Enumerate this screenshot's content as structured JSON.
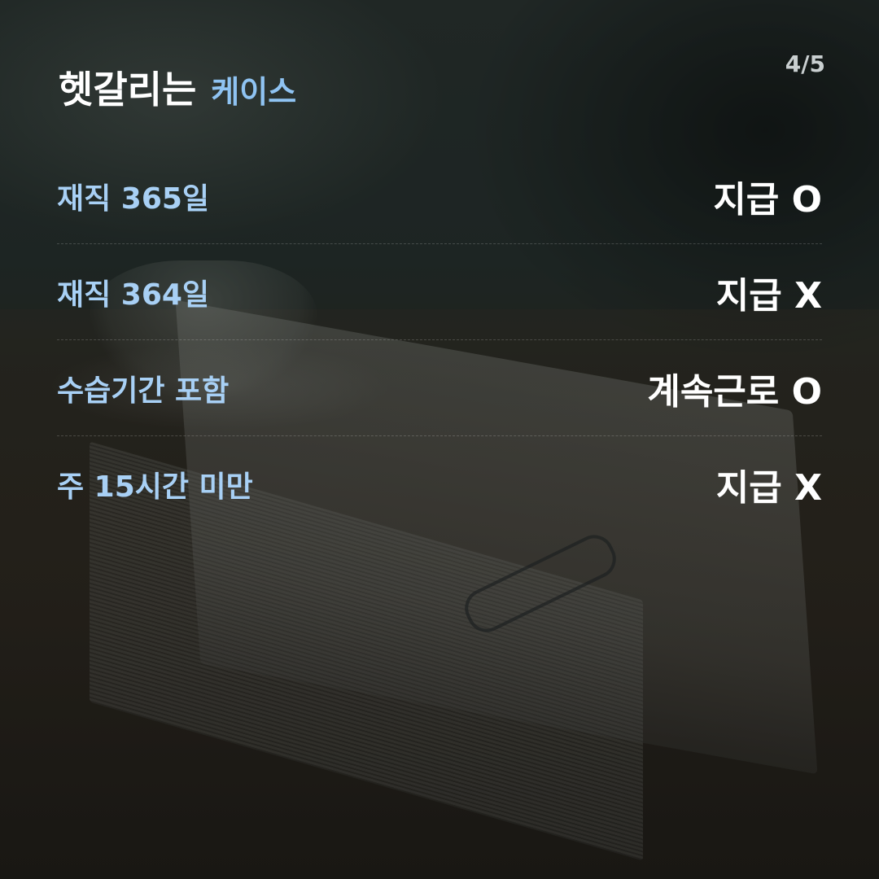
{
  "header": {
    "title_main": "헷갈리는",
    "title_accent": "케이스",
    "page_indicator": "4/5"
  },
  "colors": {
    "accent_blue": "#8fc3f2",
    "label_blue": "#a8d0f5",
    "text_white": "#ffffff"
  },
  "cases": [
    {
      "label": "재직 365일",
      "value": "지급 O"
    },
    {
      "label": "재직 364일",
      "value": "지급 X"
    },
    {
      "label": "수습기간 포함",
      "value": "계속근로 O"
    },
    {
      "label": "주 15시간 미만",
      "value": "지급 X"
    }
  ]
}
